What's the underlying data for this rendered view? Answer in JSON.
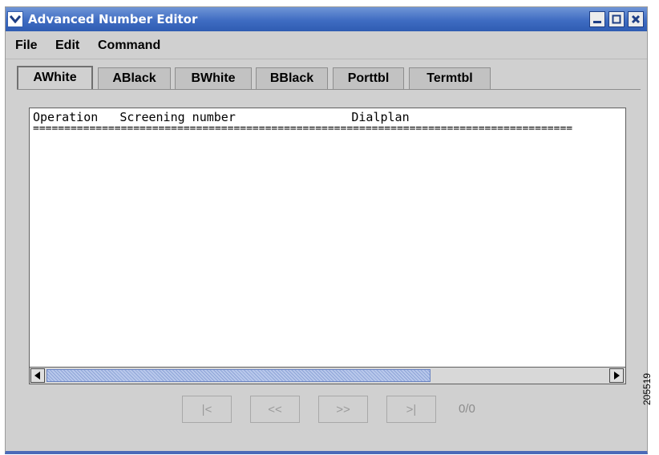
{
  "window": {
    "title": "Advanced Number Editor"
  },
  "menubar": {
    "items": [
      "File",
      "Edit",
      "Command"
    ]
  },
  "tabs": [
    {
      "label": "AWhite",
      "selected": true
    },
    {
      "label": "ABlack",
      "selected": false
    },
    {
      "label": "BWhite",
      "selected": false
    },
    {
      "label": "BBlack",
      "selected": false
    },
    {
      "label": "Porttbl",
      "selected": false
    },
    {
      "label": "Termtbl",
      "selected": false
    }
  ],
  "table": {
    "header": "Operation   Screening number                Dialplan",
    "separator": "======================================================================================"
  },
  "pagination": {
    "first_label": "|<",
    "prev_label": "<<",
    "next_label": ">>",
    "last_label": ">|",
    "page_count": "0/0"
  },
  "side_label": "205519",
  "colors": {
    "titlebar": "#3f6cc2",
    "thumb": "#8fa6d8",
    "window_bg": "#d0d0d0"
  }
}
